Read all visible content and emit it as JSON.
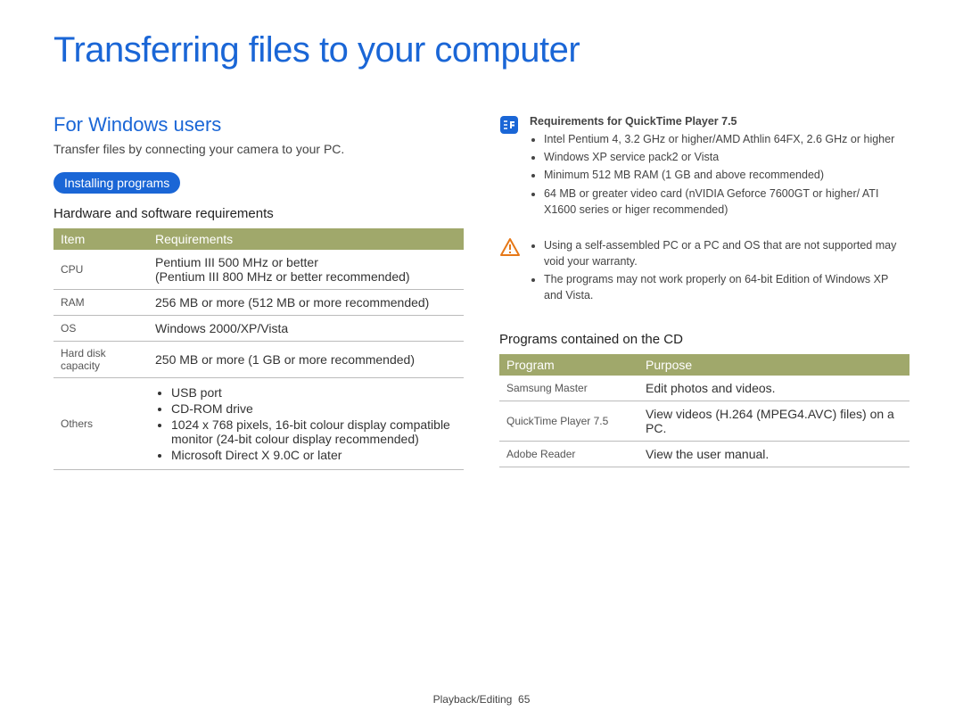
{
  "title": "Transferring files to your computer",
  "footer": {
    "section": "Playback/Editing",
    "page": "65"
  },
  "left": {
    "heading": "For Windows users",
    "intro": "Transfer files by connecting your camera to your PC.",
    "pill": "Installing programs",
    "sub": "Hardware and software requirements",
    "table": {
      "head": [
        "Item",
        "Requirements"
      ],
      "rows": [
        {
          "item": "CPU",
          "req": "Pentium III 500 MHz or better\n(Pentium III 800 MHz or better recommended)"
        },
        {
          "item": "RAM",
          "req": "256 MB or more (512 MB or more recommended)"
        },
        {
          "item": "OS",
          "req": "Windows 2000/XP/Vista"
        },
        {
          "item": "Hard disk capacity",
          "req": "250 MB or more (1 GB or more recommended)"
        },
        {
          "item": "Others",
          "req_list": [
            "USB port",
            "CD-ROM drive",
            "1024 x 768 pixels, 16-bit colour display compatible monitor (24-bit colour display recommended)",
            "Microsoft Direct X 9.0C or later"
          ]
        }
      ]
    }
  },
  "right": {
    "note1": {
      "icon": "note-icon",
      "heading": "Requirements for QuickTime Player 7.5",
      "items": [
        "Intel Pentium 4, 3.2 GHz or higher/AMD Athlin 64FX, 2.6 GHz or higher",
        "Windows XP service pack2 or Vista",
        "Minimum 512 MB RAM (1 GB and above recommended)",
        "64 MB or greater video card (nVIDIA Geforce 7600GT or higher/ ATI X1600 series or higer recommended)"
      ]
    },
    "note2": {
      "icon": "warning-icon",
      "items": [
        "Using a self-assembled PC or a PC and OS that are not supported may void your warranty.",
        "The programs may not work properly on 64-bit Edition of Windows XP and Vista."
      ]
    },
    "sub": "Programs contained on the CD",
    "table": {
      "head": [
        "Program",
        "Purpose"
      ],
      "rows": [
        {
          "program": "Samsung Master",
          "purpose": "Edit photos and videos."
        },
        {
          "program": "QuickTime Player 7.5",
          "purpose": "View videos (H.264 (MPEG4.AVC) files) on a PC."
        },
        {
          "program": "Adobe Reader",
          "purpose": "View the user manual."
        }
      ]
    }
  }
}
